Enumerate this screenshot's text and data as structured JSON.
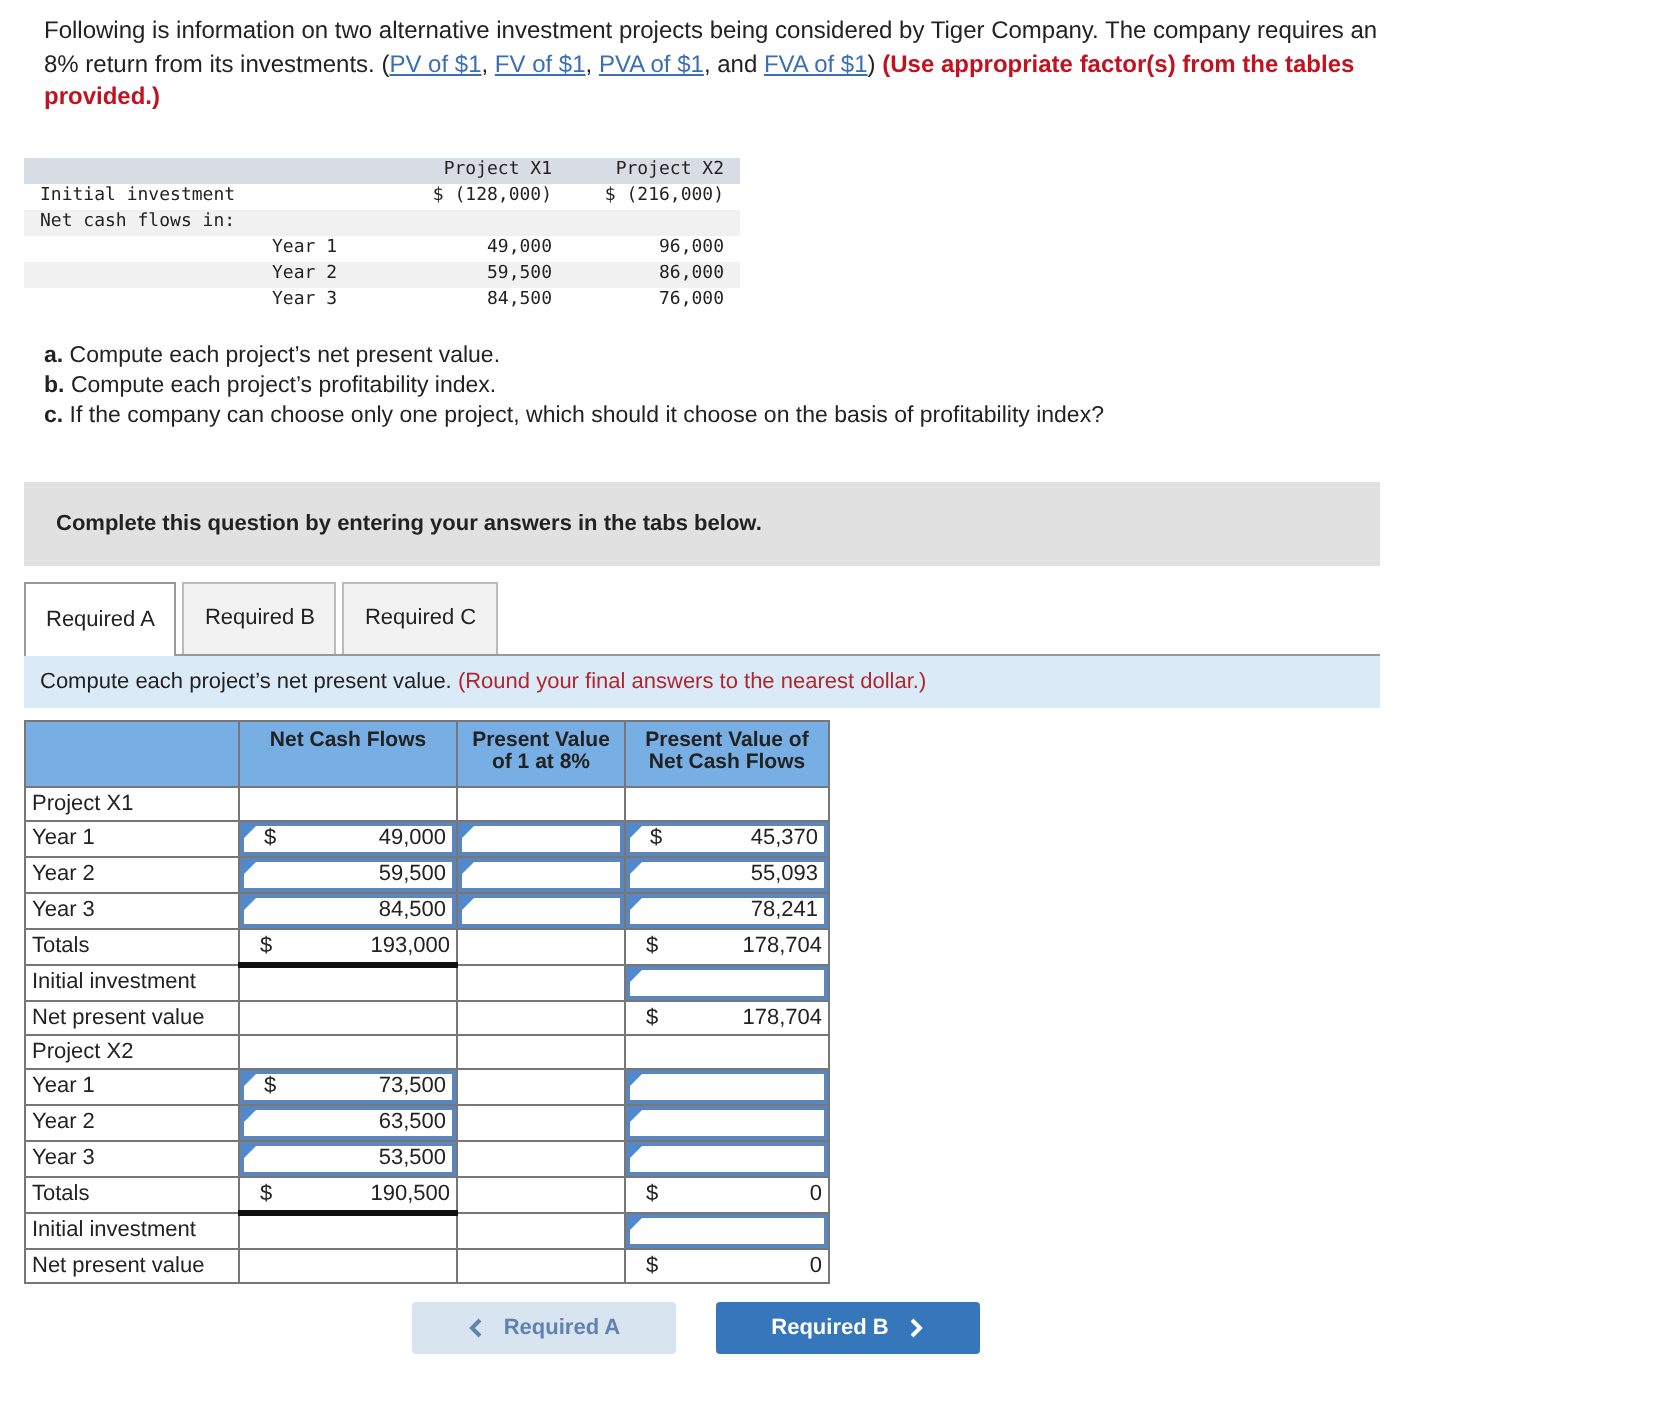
{
  "intro": {
    "parts": [
      {
        "kind": "text",
        "text": "Following is information on two alternative investment projects being considered by Tiger Company. The company requires an 8% return from its investments. ("
      },
      {
        "kind": "link",
        "text": "PV of $1"
      },
      {
        "kind": "text",
        "text": ", "
      },
      {
        "kind": "link",
        "text": "FV of $1"
      },
      {
        "kind": "text",
        "text": ", "
      },
      {
        "kind": "link",
        "text": "PVA of $1"
      },
      {
        "kind": "text",
        "text": ", and "
      },
      {
        "kind": "link",
        "text": "FVA of $1"
      },
      {
        "kind": "text",
        "text": ") "
      },
      {
        "kind": "note",
        "text": "(Use appropriate factor(s) from the tables provided.)"
      }
    ]
  },
  "info_table": {
    "columns": [
      "Project X1",
      "Project X2"
    ],
    "rows": [
      {
        "label": "Initial investment",
        "indent": false,
        "values": [
          "$ (128,000)",
          "$ (216,000)"
        ]
      },
      {
        "label": "Net cash flows in:",
        "indent": false,
        "values": []
      },
      {
        "label": "Year 1",
        "indent": true,
        "values": [
          "49,000",
          "96,000"
        ]
      },
      {
        "label": "Year 2",
        "indent": true,
        "values": [
          "59,500",
          "86,000"
        ]
      },
      {
        "label": "Year 3",
        "indent": true,
        "values": [
          "84,500",
          "76,000"
        ]
      }
    ]
  },
  "questions": [
    {
      "letter": "a.",
      "text": "Compute each project’s net present value."
    },
    {
      "letter": "b.",
      "text": "Compute each project’s profitability index."
    },
    {
      "letter": "c.",
      "text": "If the company can choose only one project, which should it choose on the basis of profitability index?"
    }
  ],
  "banner": "Complete this question by entering your answers in the tabs below.",
  "tabs": [
    {
      "label": "Required A",
      "selected": true
    },
    {
      "label": "Required B",
      "selected": false
    },
    {
      "label": "Required C",
      "selected": false
    }
  ],
  "instruction": {
    "text": "Compute each project’s net present value.",
    "note": "(Round your final answers to the nearest dollar.)"
  },
  "answer_table": {
    "columns": [
      "Net Cash Flows",
      "Present Value of 1 at 8%",
      "Present Value of Net Cash Flows"
    ],
    "rows": [
      {
        "label": "Project X1",
        "kind": "section"
      },
      {
        "label": "Year 1",
        "kind": "line",
        "cash": {
          "input": true,
          "prefix": "$",
          "value": "49,000"
        },
        "factor": {
          "input": true
        },
        "pv": {
          "input": true,
          "prefix": "$",
          "value": "45,370"
        }
      },
      {
        "label": "Year 2",
        "kind": "line",
        "cash": {
          "input": true,
          "value": "59,500"
        },
        "factor": {
          "input": true
        },
        "pv": {
          "input": true,
          "value": "55,093"
        }
      },
      {
        "label": "Year 3",
        "kind": "line",
        "cash": {
          "input": true,
          "value": "84,500"
        },
        "factor": {
          "input": true
        },
        "pv": {
          "input": true,
          "value": "78,241"
        }
      },
      {
        "label": "Totals",
        "kind": "total",
        "cash": {
          "input": false,
          "prefix": "$",
          "value": "193,000"
        },
        "pv": {
          "input": false,
          "prefix": "$",
          "value": "178,704"
        }
      },
      {
        "label": "Initial investment",
        "kind": "line",
        "pv": {
          "input": true
        }
      },
      {
        "label": "Net present value",
        "kind": "total",
        "pv": {
          "input": false,
          "prefix": "$",
          "value": "178,704"
        }
      },
      {
        "label": "Project X2",
        "kind": "section"
      },
      {
        "label": "Year 1",
        "kind": "line",
        "cash": {
          "input": true,
          "prefix": "$",
          "value": "73,500"
        },
        "pv": {
          "input": true
        }
      },
      {
        "label": "Year 2",
        "kind": "line",
        "cash": {
          "input": true,
          "value": "63,500"
        },
        "pv": {
          "input": true
        }
      },
      {
        "label": "Year 3",
        "kind": "line",
        "cash": {
          "input": true,
          "value": "53,500"
        },
        "pv": {
          "input": true
        }
      },
      {
        "label": "Totals",
        "kind": "total",
        "cash": {
          "input": false,
          "prefix": "$",
          "value": "190,500"
        },
        "pv": {
          "input": false,
          "prefix": "$",
          "value": "0"
        }
      },
      {
        "label": "Initial investment",
        "kind": "line",
        "pv": {
          "input": true
        }
      },
      {
        "label": "Net present value",
        "kind": "total",
        "pv": {
          "input": false,
          "prefix": "$",
          "value": "0"
        }
      }
    ]
  },
  "nav": [
    {
      "label": "Required A",
      "kind": "prev",
      "disabled": true
    },
    {
      "label": "Required B",
      "kind": "next",
      "disabled": false
    }
  ]
}
